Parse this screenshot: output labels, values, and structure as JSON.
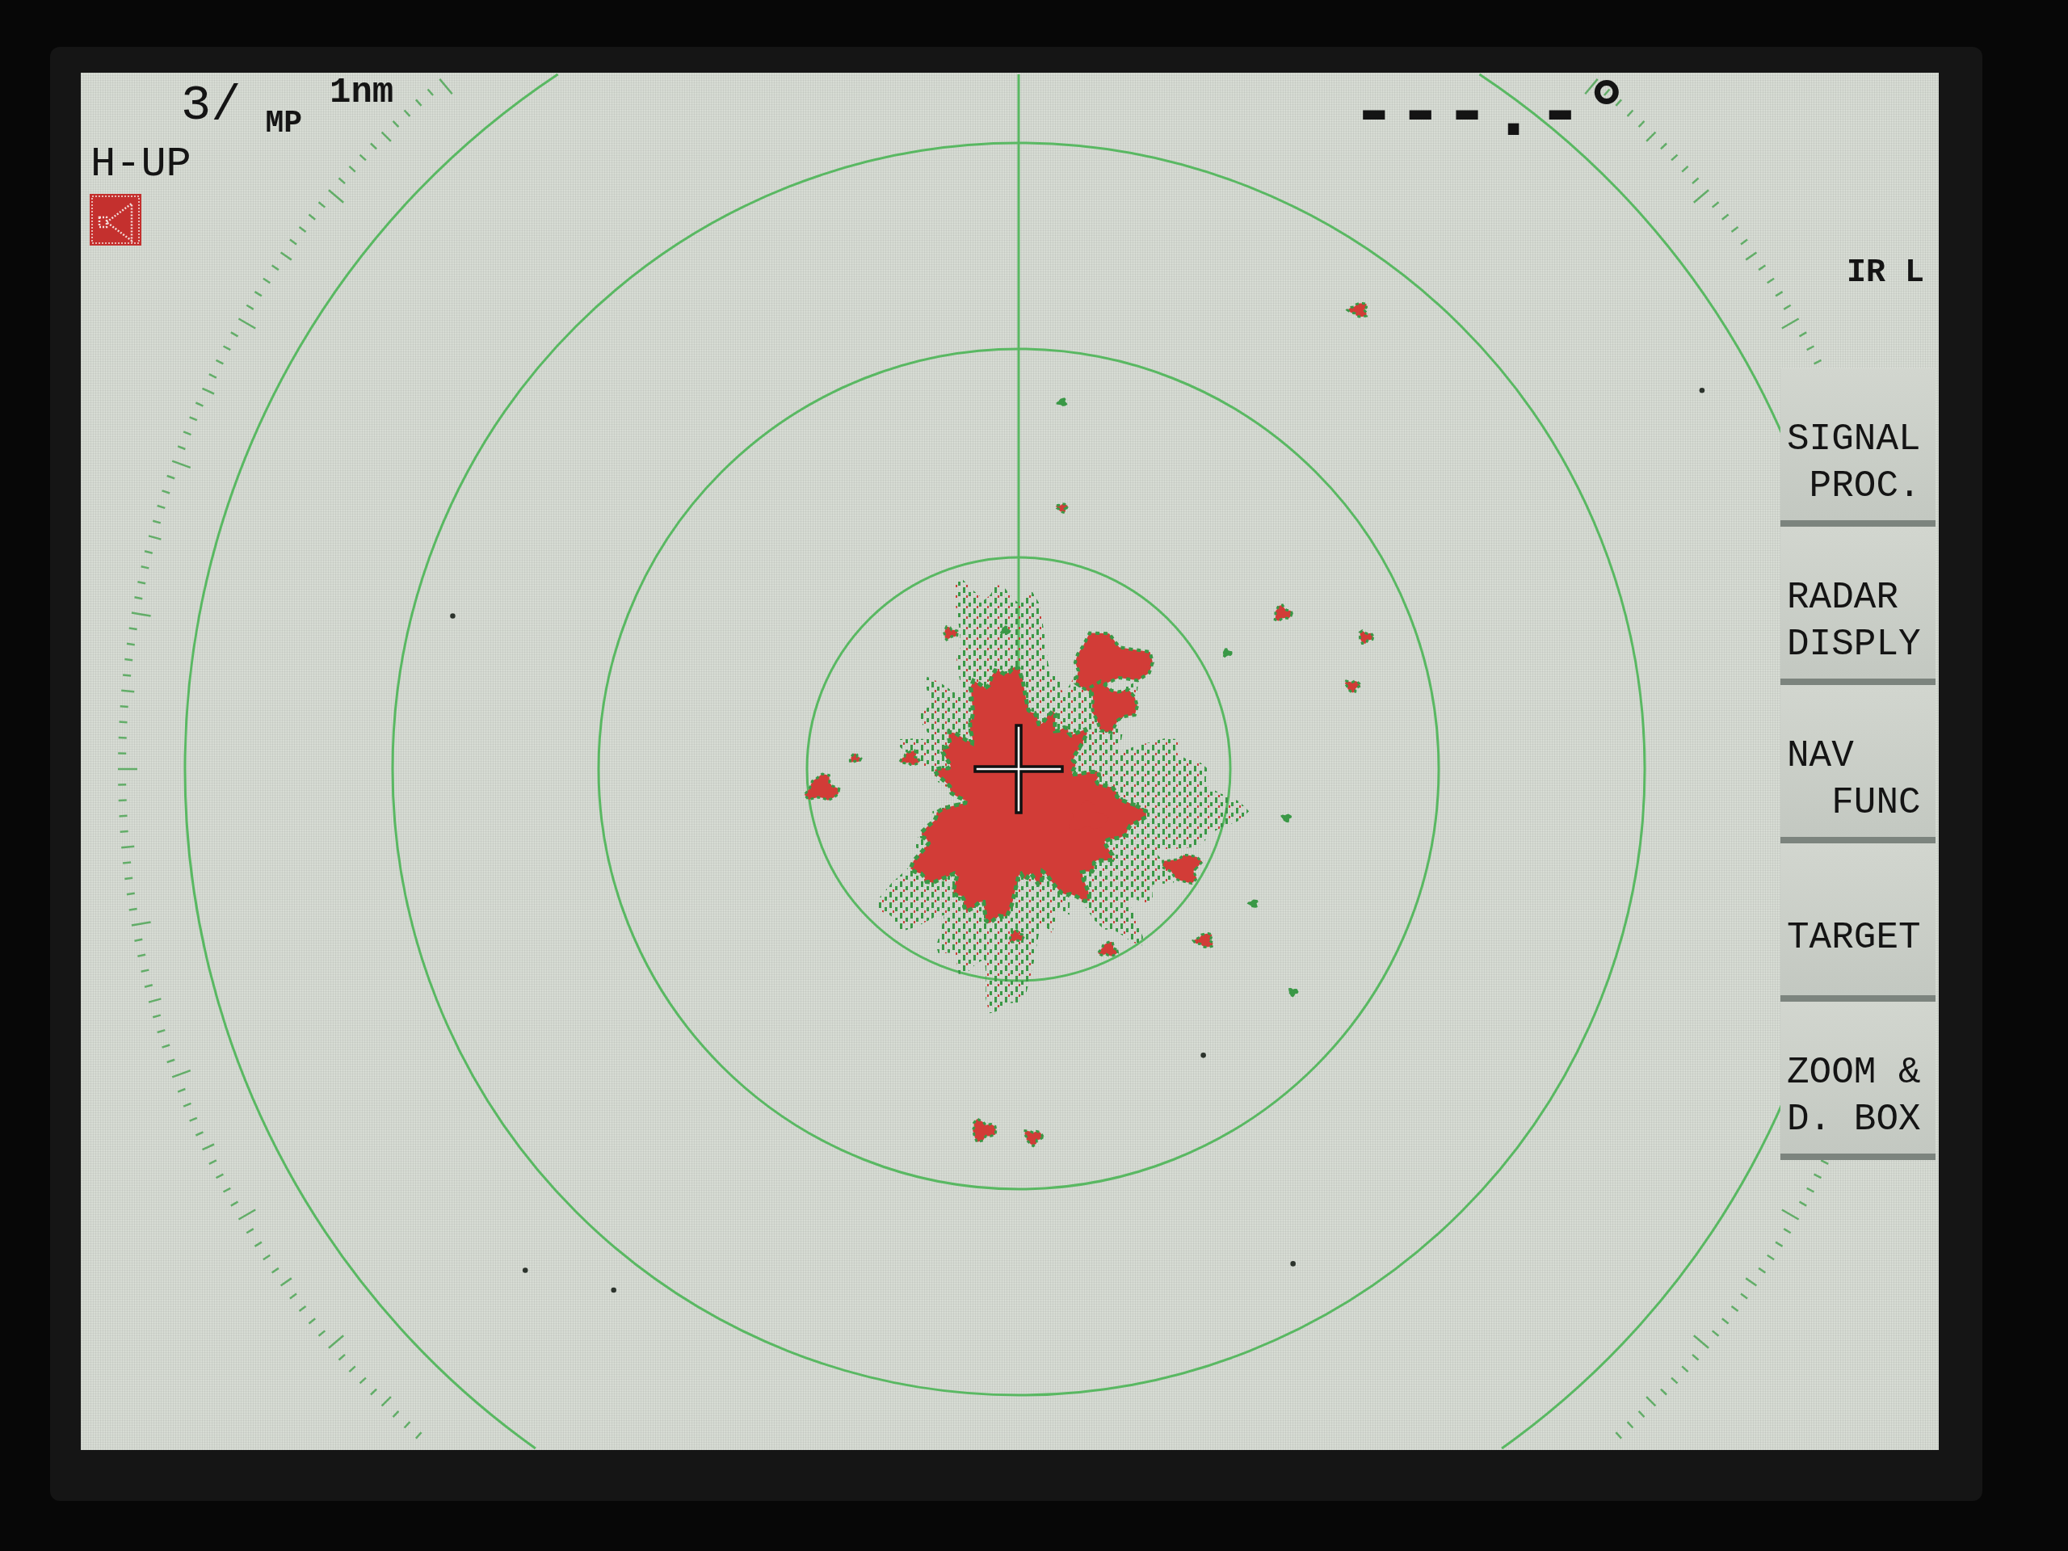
{
  "status": {
    "range": "3/",
    "pulse_mode": "MP",
    "ring_interval": "1nm",
    "orientation": "H-UP",
    "heading": "---.-°",
    "indicator": "IR L"
  },
  "menu": [
    "SIGNAL\n PROC.",
    "RADAR\nDISPLY",
    "NAV\n  FUNC",
    "TARGET",
    "ZOOM &\nD. BOX"
  ]
}
